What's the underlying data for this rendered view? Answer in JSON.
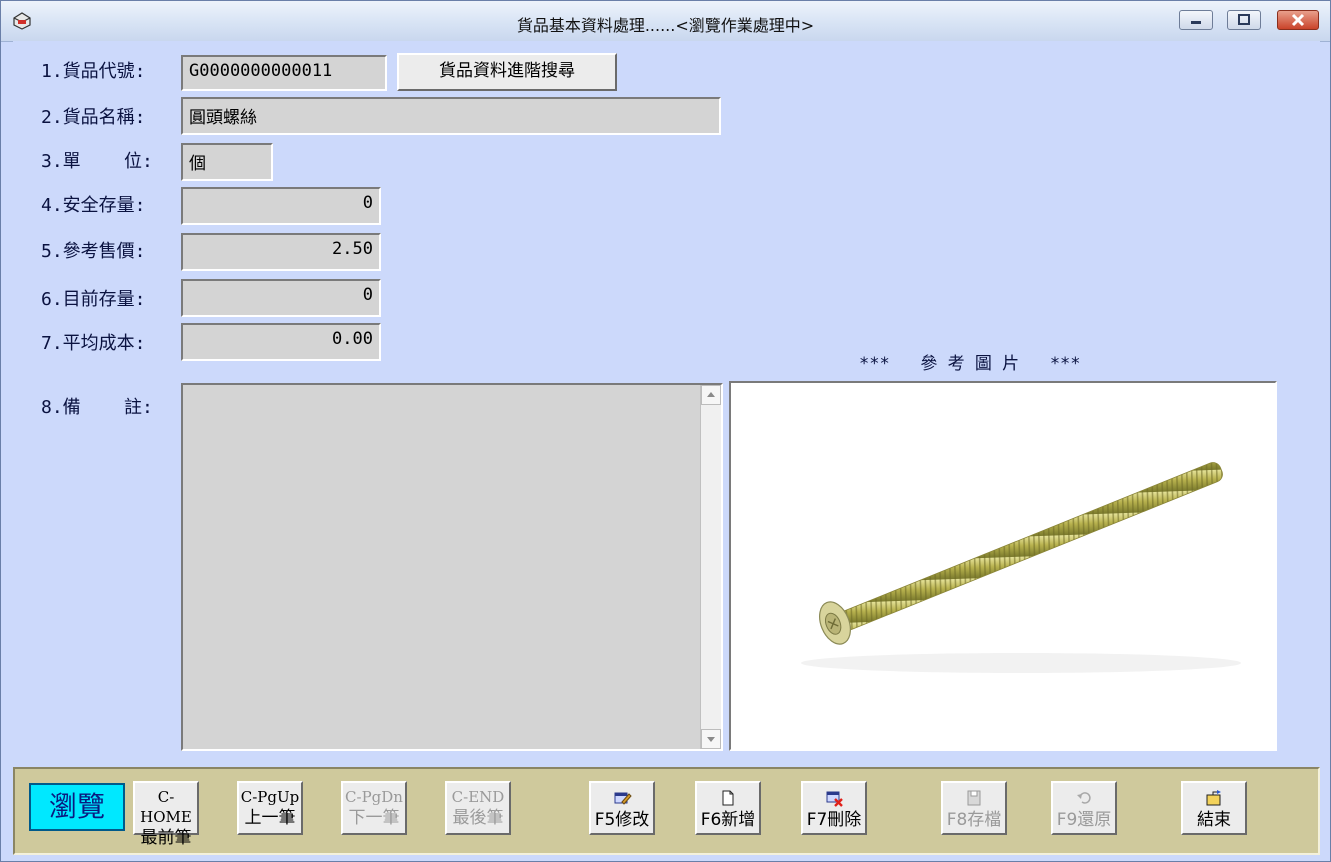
{
  "window": {
    "title": "貨品基本資料處理......<瀏覽作業處理中>"
  },
  "form": {
    "fields": [
      {
        "label": "1.貨品代號:",
        "value": "G0000000000011"
      },
      {
        "label": "2.貨品名稱:",
        "value": "圓頭螺絲"
      },
      {
        "label": "3.單    位:",
        "value": "個"
      },
      {
        "label": "4.安全存量:",
        "value": "0"
      },
      {
        "label": "5.參考售價:",
        "value": "2.50"
      },
      {
        "label": "6.目前存量:",
        "value": "0"
      },
      {
        "label": "7.平均成本:",
        "value": "0.00"
      },
      {
        "label": "8.備    註:",
        "value": ""
      }
    ],
    "search_button": "貨品資料進階搜尋",
    "picture_caption": "***   參 考 圖 片   ***"
  },
  "toolbar": {
    "mode": "瀏覽",
    "nav": [
      {
        "key": "C-HOME",
        "label": "最前筆",
        "enabled": true
      },
      {
        "key": "C-PgUp",
        "label": "上一筆",
        "enabled": true
      },
      {
        "key": "C-PgDn",
        "label": "下一筆",
        "enabled": false
      },
      {
        "key": "C-END",
        "label": "最後筆",
        "enabled": false
      }
    ],
    "actions": [
      {
        "label": "F5修改",
        "icon": "edit-icon",
        "enabled": true
      },
      {
        "label": "F6新增",
        "icon": "new-document-icon",
        "enabled": true
      },
      {
        "label": "F7刪除",
        "icon": "delete-icon",
        "enabled": true
      },
      {
        "label": "F8存檔",
        "icon": "save-icon",
        "enabled": false
      },
      {
        "label": "F9還原",
        "icon": "undo-icon",
        "enabled": false
      },
      {
        "label": "結束",
        "icon": "exit-icon",
        "enabled": true
      }
    ]
  },
  "colors": {
    "form_background": "#ccd9fb",
    "toolbar_background": "#cfc99c",
    "mode_highlight": "#00e8ff"
  }
}
